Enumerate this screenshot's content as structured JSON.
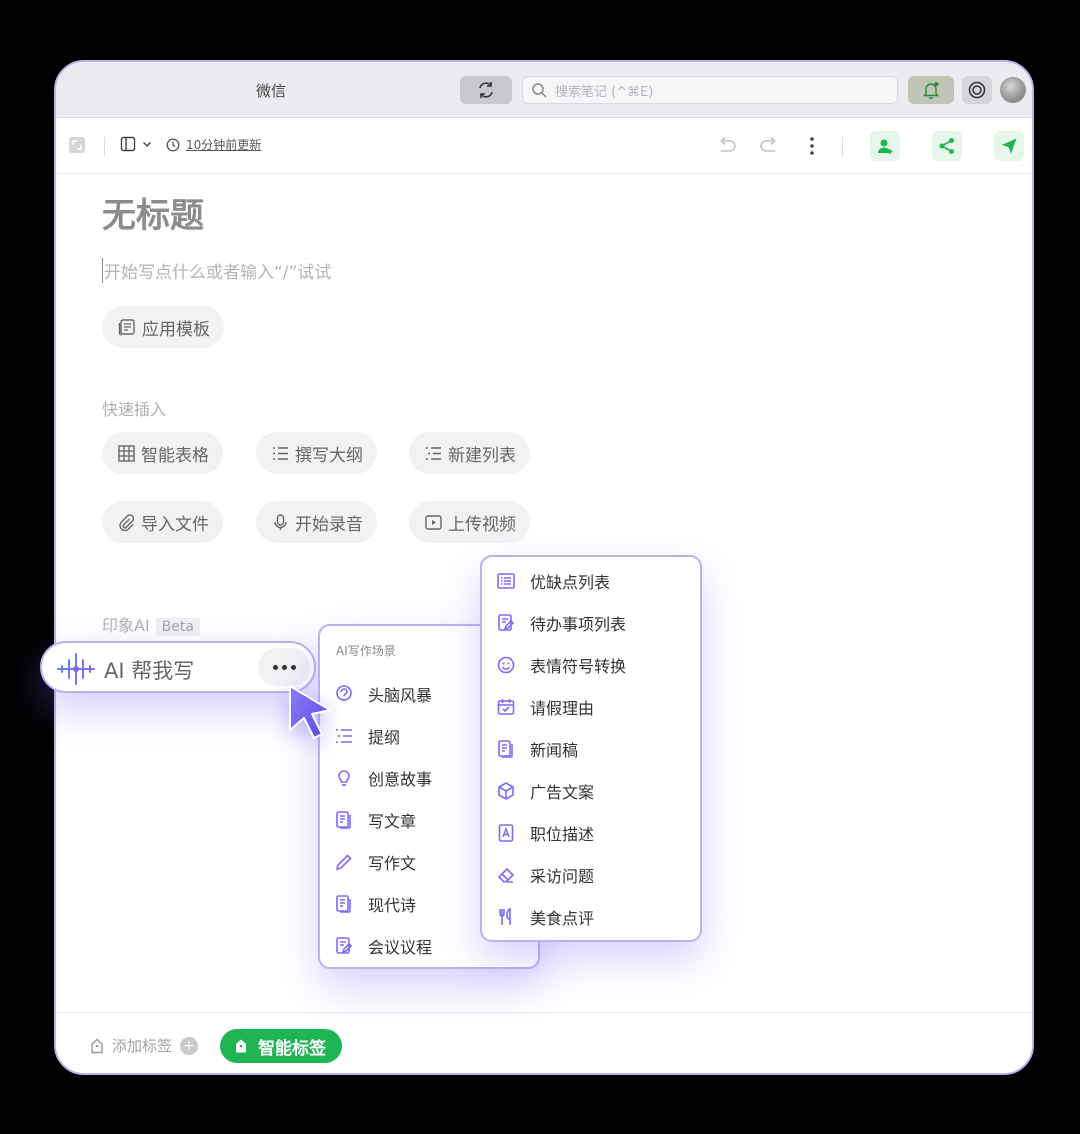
{
  "titlebar": {
    "title": "微信",
    "search_placeholder": "搜索笔记 (^⌘E)"
  },
  "toolbar": {
    "updated_text": "10分钟前更新"
  },
  "document": {
    "title": "无标题",
    "placeholder": "开始写点什么或者输入“/”试试",
    "template_button": "应用模板"
  },
  "quick_insert": {
    "label": "快速插入",
    "items": [
      "智能表格",
      "撰写大纲",
      "新建列表",
      "导入文件",
      "开始录音",
      "上传视频"
    ]
  },
  "ai_section": {
    "label": "印象AI",
    "badge": "Beta",
    "button_label": "AI 帮我写"
  },
  "writing_scenes": {
    "header": "AI写作场景",
    "items": [
      "头脑风暴",
      "提纲",
      "创意故事",
      "写文章",
      "写作文",
      "现代诗",
      "会议议程"
    ]
  },
  "more_scenes": {
    "items": [
      "优缺点列表",
      "待办事项列表",
      "表情符号转换",
      "请假理由",
      "新闻稿",
      "广告文案",
      "职位描述",
      "采访问题",
      "美食点评"
    ]
  },
  "footer": {
    "add_tag": "添加标签",
    "smart_tag": "智能标签"
  },
  "colors": {
    "accent_purple": "#7b6cf6",
    "brand_green": "#1fb552",
    "panel_border": "#b8b2f2"
  }
}
